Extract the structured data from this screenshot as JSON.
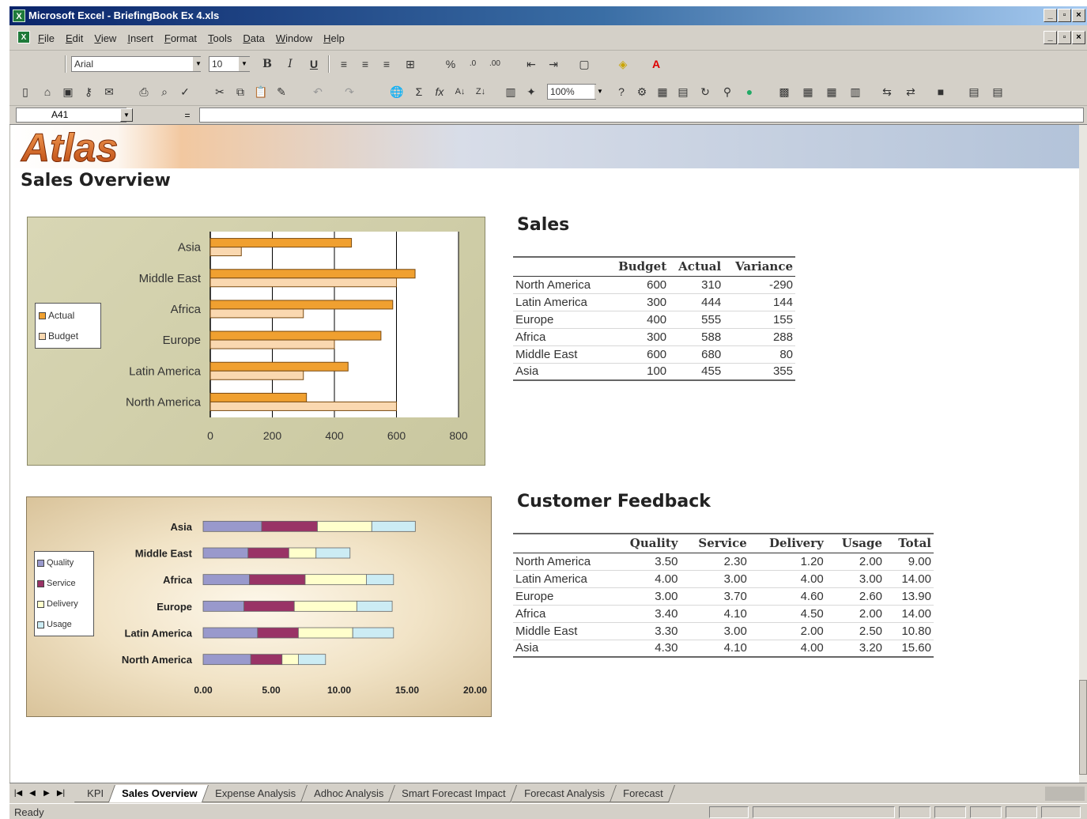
{
  "window": {
    "title": "Microsoft Excel - BriefingBook Ex 4.xls",
    "menus": [
      "File",
      "Edit",
      "View",
      "Insert",
      "Format",
      "Tools",
      "Data",
      "Window",
      "Help"
    ]
  },
  "format_toolbar": {
    "font_name": "Arial",
    "font_size": "10"
  },
  "standard_toolbar": {
    "zoom": "100%"
  },
  "formula_bar": {
    "name_box": "A41",
    "equals": "="
  },
  "sheet": {
    "brand": "Atlas",
    "page_title": "Sales Overview"
  },
  "sales_table": {
    "title": "Sales",
    "columns": [
      "Budget",
      "Actual",
      "Variance"
    ],
    "rows": [
      {
        "region": "North America",
        "budget": "600",
        "actual": "310",
        "variance": "-290"
      },
      {
        "region": "Latin America",
        "budget": "300",
        "actual": "444",
        "variance": "144"
      },
      {
        "region": "Europe",
        "budget": "400",
        "actual": "555",
        "variance": "155"
      },
      {
        "region": "Africa",
        "budget": "300",
        "actual": "588",
        "variance": "288"
      },
      {
        "region": "Middle East",
        "budget": "600",
        "actual": "680",
        "variance": "80"
      },
      {
        "region": "Asia",
        "budget": "100",
        "actual": "455",
        "variance": "355"
      }
    ]
  },
  "feedback_table": {
    "title": "Customer Feedback",
    "columns": [
      "Quality",
      "Service",
      "Delivery",
      "Usage",
      "Total"
    ],
    "rows": [
      {
        "region": "North America",
        "quality": "3.50",
        "service": "2.30",
        "delivery": "1.20",
        "usage": "2.00",
        "total": "9.00"
      },
      {
        "region": "Latin America",
        "quality": "4.00",
        "service": "3.00",
        "delivery": "4.00",
        "usage": "3.00",
        "total": "14.00"
      },
      {
        "region": "Europe",
        "quality": "3.00",
        "service": "3.70",
        "delivery": "4.60",
        "usage": "2.60",
        "total": "13.90"
      },
      {
        "region": "Africa",
        "quality": "3.40",
        "service": "4.10",
        "delivery": "4.50",
        "usage": "2.00",
        "total": "14.00"
      },
      {
        "region": "Middle East",
        "quality": "3.30",
        "service": "3.00",
        "delivery": "2.00",
        "usage": "2.50",
        "total": "10.80"
      },
      {
        "region": "Asia",
        "quality": "4.30",
        "service": "4.10",
        "delivery": "4.00",
        "usage": "3.20",
        "total": "15.60"
      }
    ]
  },
  "chart_data": [
    {
      "type": "bar",
      "orientation": "horizontal",
      "categories": [
        "Asia",
        "Middle East",
        "Africa",
        "Europe",
        "Latin America",
        "North America"
      ],
      "series": [
        {
          "name": "Actual",
          "color": "#f0a030",
          "values": [
            455,
            660,
            588,
            550,
            444,
            310
          ]
        },
        {
          "name": "Budget",
          "color": "#fad8b0",
          "values": [
            100,
            600,
            300,
            400,
            300,
            600
          ]
        }
      ],
      "xlim": [
        0,
        800
      ],
      "xticks": [
        "0",
        "200",
        "400",
        "600",
        "800"
      ],
      "legend": "left",
      "grid": true
    },
    {
      "type": "bar",
      "orientation": "horizontal",
      "stacked": true,
      "categories": [
        "Asia",
        "Middle East",
        "Africa",
        "Europe",
        "Latin America",
        "North America"
      ],
      "series": [
        {
          "name": "Quality",
          "color": "#9999cc",
          "values": [
            4.3,
            3.3,
            3.4,
            3.0,
            4.0,
            3.5
          ]
        },
        {
          "name": "Service",
          "color": "#993366",
          "values": [
            4.1,
            3.0,
            4.1,
            3.7,
            3.0,
            2.3
          ]
        },
        {
          "name": "Delivery",
          "color": "#ffffcc",
          "values": [
            4.0,
            2.0,
            4.5,
            4.6,
            4.0,
            1.2
          ]
        },
        {
          "name": "Usage",
          "color": "#ccecf4",
          "values": [
            3.2,
            2.5,
            2.0,
            2.6,
            3.0,
            2.0
          ]
        }
      ],
      "xlim": [
        0,
        20
      ],
      "xticks": [
        "0.00",
        "5.00",
        "10.00",
        "15.00",
        "20.00"
      ],
      "legend": "left",
      "grid": false
    }
  ],
  "sheet_tabs": [
    "KPI",
    "Sales Overview",
    "Expense Analysis",
    "Adhoc Analysis",
    "Smart Forecast Impact",
    "Forecast Analysis",
    "Forecast"
  ],
  "active_tab": "Sales Overview",
  "status": {
    "text": "Ready"
  }
}
